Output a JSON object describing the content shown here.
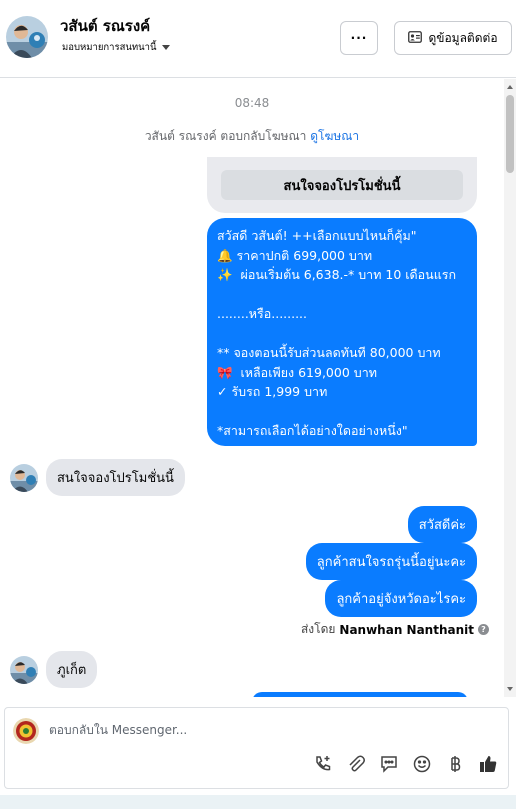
{
  "header": {
    "name": "วสันต์ รณรงค์",
    "assign_label": "มอบหมายการสนทนานี้",
    "more_label": "···",
    "contact_label": "ดูข้อมูลติดต่อ"
  },
  "thread": {
    "time": "08:48",
    "ad_reply_text": "วสันต์ รณรงค์ ตอบกลับโฆษณา",
    "ad_link": "ดูโฆษณา",
    "ad_button": "สนใจจองโปรโมชั่นนี้",
    "promo_text": "สวัสดี วสันต์! ++เลือกแบบไหนก็คุ้ม\"\n🔔 ราคาปกติ 699,000 บาท\n✨  ผ่อนเริ่มต้น 6,638.-* บาท 10 เดือนแรก\n\n........หรือ.........\n\n** จองตอนนี้รับส่วนลดทันที 80,000 บาท\n🎀  เหลือเพียง 619,000 บาท\n✓ รับรถ 1,999 บาท\n\n*สามารถเลือกได้อย่างใดอย่างหนึ่ง\"",
    "incoming_1": "สนใจจองโปรโมชั่นนี้",
    "outgoing": [
      "สวัสดีค่ะ",
      "ลูกค้าสนใจรถรุ่นนี้อยู่นะคะ",
      "ลูกค้าอยู่จังหวัดอะไรคะ"
    ],
    "sent_by_prefix": "ส่งโดย",
    "sent_by_name": "Nanwhan Nanthanit",
    "incoming_2": "ภูเก็ต"
  },
  "composer": {
    "placeholder": "ตอบกลับใน Messenger...",
    "tools": [
      "call-add-icon",
      "attach-icon",
      "saved-reply-icon",
      "emoji-icon",
      "baht-icon",
      "like-icon"
    ]
  },
  "colors": {
    "accent": "#0a7cff",
    "incoming_bubble": "#e4e6eb",
    "link": "#1b74e4"
  }
}
